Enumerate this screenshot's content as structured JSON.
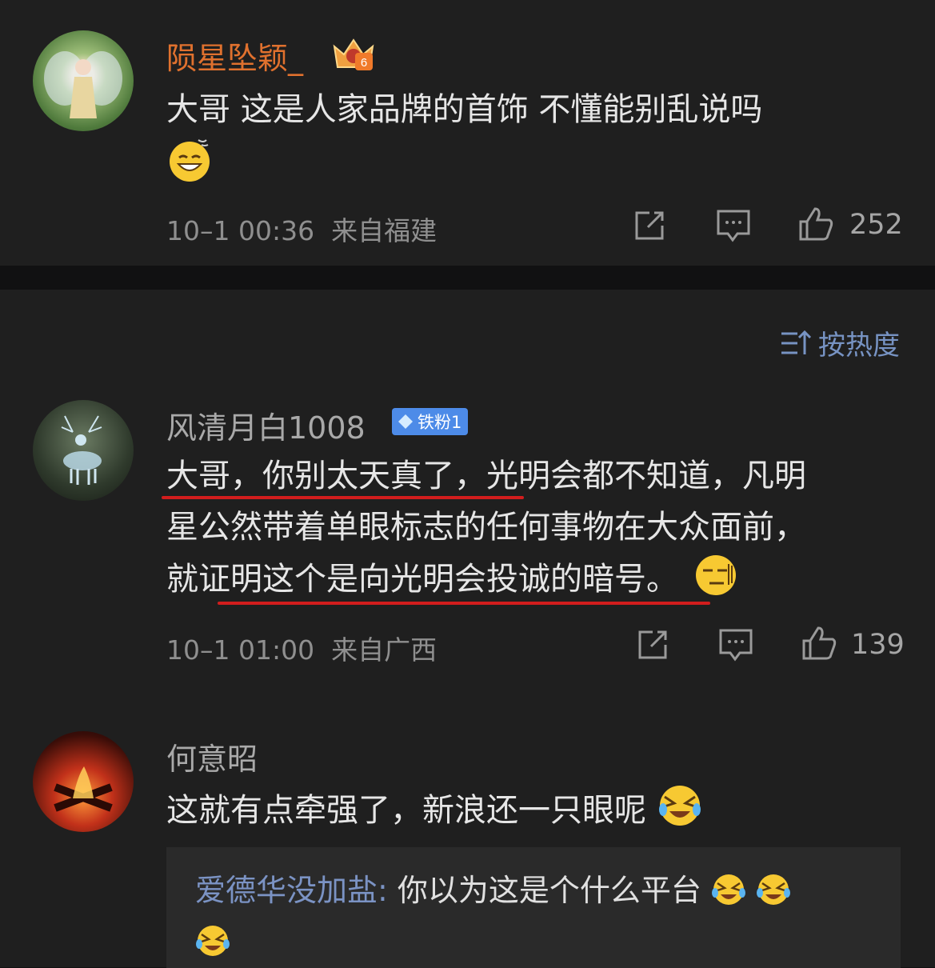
{
  "colors": {
    "background": "#111112",
    "card": "#1f1f1f",
    "link_blue": "#7b93c4",
    "vip_orange": "#e0712e",
    "underline_red": "#d21d1d",
    "badge_blue": "#4d8be8"
  },
  "top_comment": {
    "username": "陨星坠颖_",
    "text": "大哥 这是人家品牌的首饰 不懂能别乱说吗",
    "time": "10–1 00:36",
    "location": "来自福建",
    "likes": "252",
    "vip_badge_level": "6"
  },
  "sort": {
    "label": "按热度",
    "icon": "sort-icon"
  },
  "comments": [
    {
      "username": "风清月白1008",
      "badge": "铁粉1",
      "text_line1": "大哥，你别太天真了，光明会都不知道，凡明",
      "text_line2": "星公然带着单眼标志的任何事物在大众面前，",
      "text_line3": "就证明这个是向光明会投诚的暗号。",
      "time": "10–1 01:00",
      "location": "来自广西",
      "likes": "139"
    },
    {
      "username": "何意昭",
      "text": "这就有点牵强了，新浪还一只眼呢",
      "reply": {
        "name": "爱德华没加盐",
        "separator": ": ",
        "text": "你以为这是个什么平台"
      }
    }
  ],
  "icons": [
    "share-icon",
    "comment-icon",
    "like-icon",
    "grinning-emoji",
    "smirk-emoji",
    "laugh-cry-emoji"
  ]
}
